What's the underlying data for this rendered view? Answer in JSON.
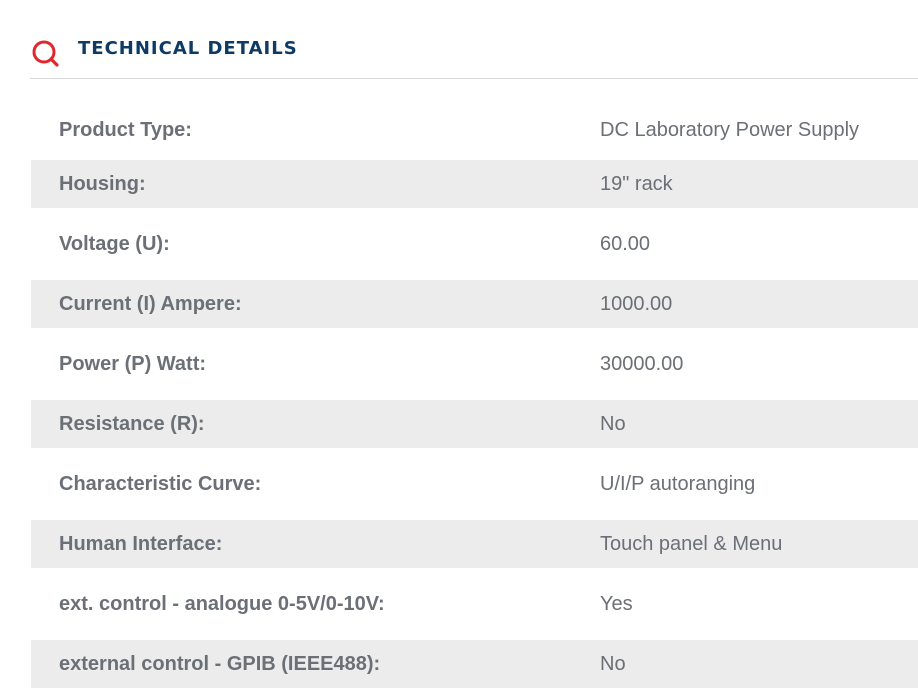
{
  "header": {
    "title": "TECHNICAL DETAILS",
    "icon": "search-icon",
    "icon_color": "#e3262b",
    "title_color": "#0d3b66"
  },
  "rows": [
    {
      "label": "Product Type:",
      "value": "DC Laboratory Power Supply"
    },
    {
      "label": "Housing:",
      "value": "19\" rack"
    },
    {
      "label": "Voltage (U):",
      "value": "60.00"
    },
    {
      "label": "Current (I) Ampere:",
      "value": "1000.00"
    },
    {
      "label": "Power (P) Watt:",
      "value": "30000.00"
    },
    {
      "label": "Resistance (R):",
      "value": "No"
    },
    {
      "label": "Characteristic Curve:",
      "value": "U/I/P autoranging"
    },
    {
      "label": "Human Interface:",
      "value": "Touch panel & Menu"
    },
    {
      "label": "ext. control - analogue 0-5V/0-10V:",
      "value": "Yes"
    },
    {
      "label": "external control - GPIB (IEEE488):",
      "value": "No"
    }
  ]
}
